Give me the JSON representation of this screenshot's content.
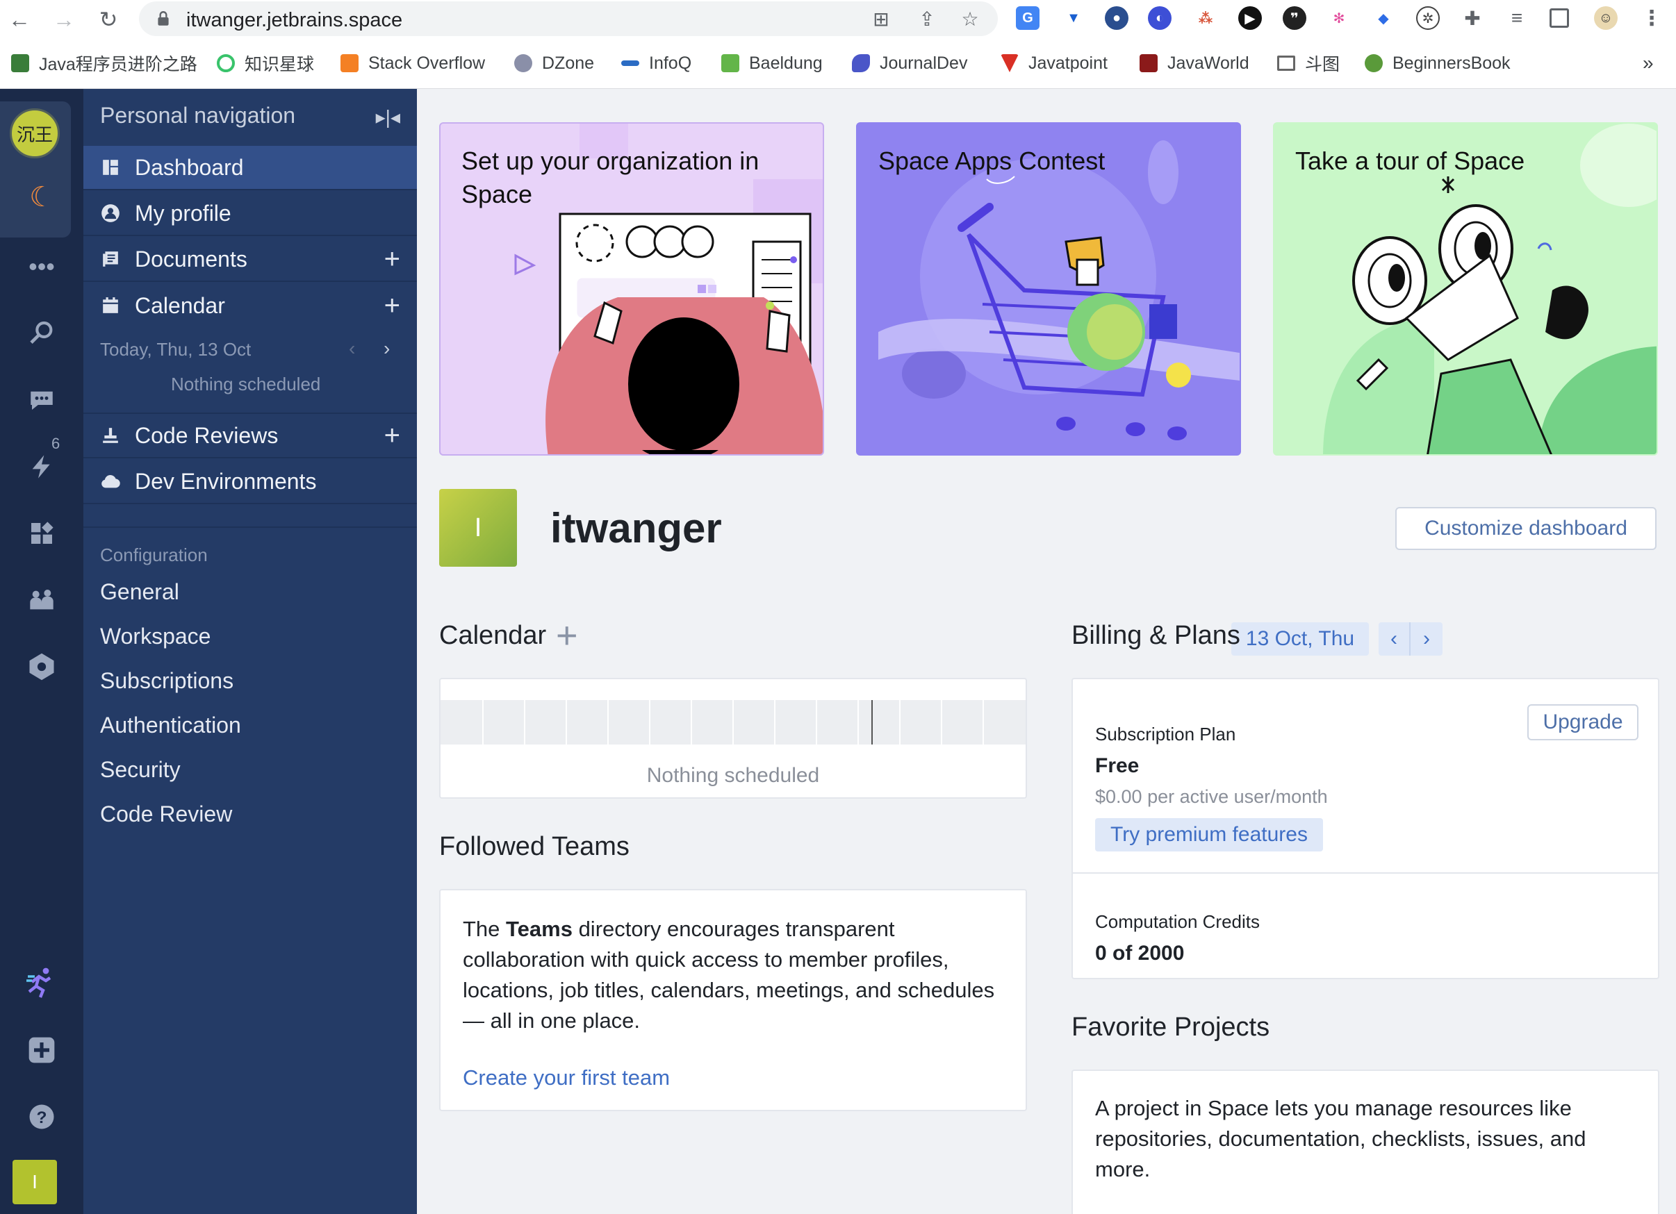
{
  "browser": {
    "url": "itwanger.jetbrains.space",
    "bookmarks": [
      {
        "label": "Java程序员进阶之路",
        "color": "#3a7d3a"
      },
      {
        "label": "知识星球",
        "color": "#39c36b"
      },
      {
        "label": "Stack Overflow",
        "color": "#f48024"
      },
      {
        "label": "DZone",
        "color": "#8a8fa8"
      },
      {
        "label": "InfoQ",
        "color": "#2b6cc4"
      },
      {
        "label": "Baeldung",
        "color": "#63b549"
      },
      {
        "label": "JournalDev",
        "color": "#4a56c8"
      },
      {
        "label": "Javatpoint",
        "color": "#d93025"
      },
      {
        "label": "JavaWorld",
        "color": "#8b1a1a"
      },
      {
        "label": "斗图",
        "color": "#777777"
      },
      {
        "label": "BeginnersBook",
        "color": "#5a9a3a"
      }
    ],
    "more": "»"
  },
  "rail": {
    "avatar_text": "沉王",
    "badge": "6",
    "user_initial": "I"
  },
  "sidebar": {
    "title": "Personal navigation",
    "items": [
      {
        "label": "Dashboard"
      },
      {
        "label": "My profile"
      },
      {
        "label": "Documents"
      },
      {
        "label": "Calendar"
      },
      {
        "label": "Code Reviews"
      },
      {
        "label": "Dev Environments"
      }
    ],
    "calendar_date": "Today, Thu, 13 Oct",
    "calendar_empty": "Nothing scheduled",
    "config_heading": "Configuration",
    "config_items": [
      "General",
      "Workspace",
      "Subscriptions",
      "Authentication",
      "Security",
      "Code Review"
    ]
  },
  "banners": [
    {
      "title": "Set up your organization in Space"
    },
    {
      "title": "Space Apps Contest"
    },
    {
      "title": "Take a tour of Space"
    }
  ],
  "profile": {
    "initial": "I",
    "name": "itwanger",
    "customize": "Customize dashboard"
  },
  "calendar": {
    "title": "Calendar",
    "date": "13 Oct, Thu",
    "empty": "Nothing scheduled"
  },
  "teams": {
    "title": "Followed Teams",
    "text_pre": "The ",
    "text_bold": "Teams",
    "text_post": " directory encourages transparent collaboration with quick access to member profiles, locations, job titles, calendars, meetings, and schedules — all in one place.",
    "link": "Create your first team"
  },
  "billing": {
    "title": "Billing & Plans",
    "plan_label": "Subscription Plan",
    "upgrade": "Upgrade",
    "plan_name": "Free",
    "price": "$0.00 per active user/month",
    "premium": "Try premium features",
    "credits_label": "Computation Credits",
    "credits_value": "0 of 2000"
  },
  "projects": {
    "title": "Favorite Projects",
    "text": "A project in Space lets you manage resources like repositories, documentation, checklists, issues, and more."
  }
}
